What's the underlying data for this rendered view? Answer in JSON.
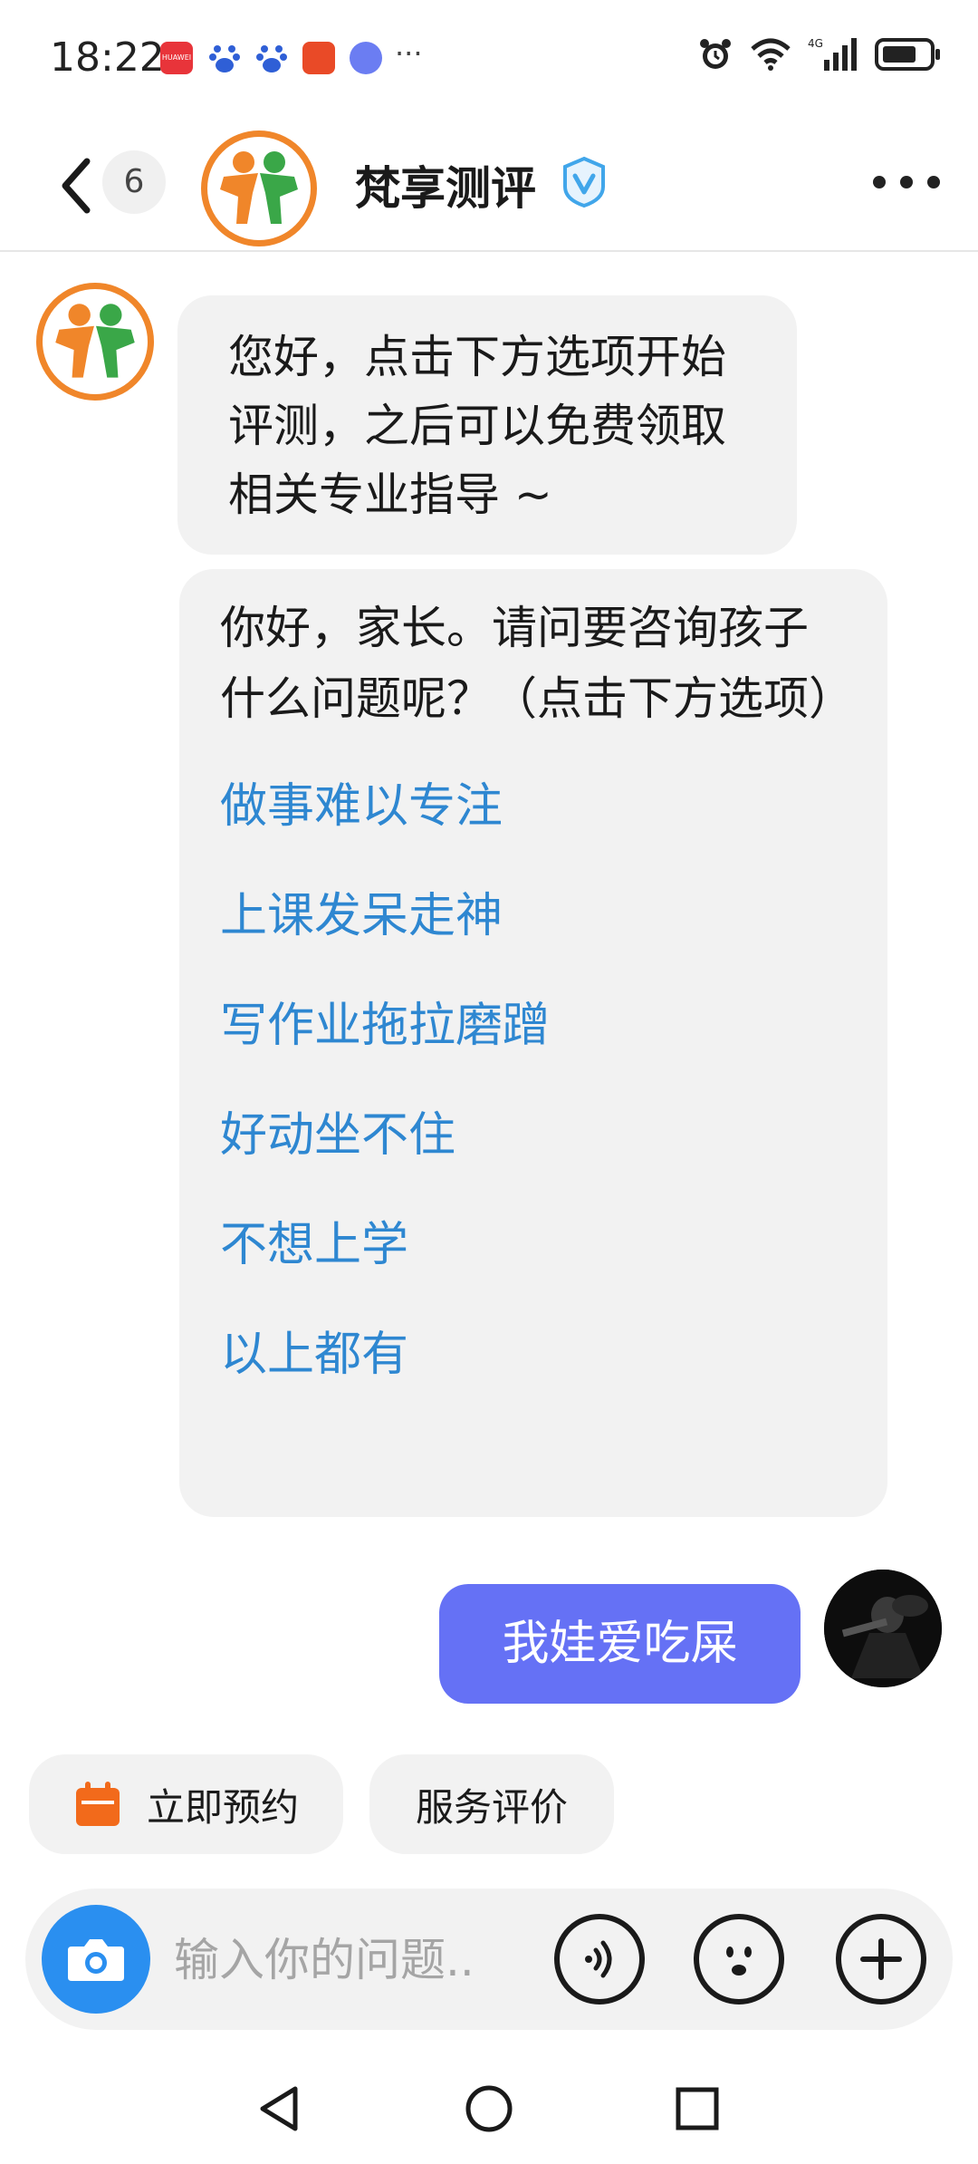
{
  "status_bar": {
    "time": "18:22",
    "huawei_label": "HUAWEI",
    "more": "···",
    "network": "4G"
  },
  "header": {
    "unread_count": "6",
    "title": "梵享测评"
  },
  "messages": {
    "greeting": "您好，点击下方选项开始评测，之后可以免费领取相关专业指导 ~",
    "question": "你好，家长。请问要咨询孩子什么问题呢？（点击下方选项）",
    "options": [
      "做事难以专注",
      "上课发呆走神",
      "写作业拖拉磨蹭",
      "好动坐不住",
      "不想上学",
      "以上都有"
    ],
    "user_reply": "我娃爱吃屎"
  },
  "quick_actions": {
    "booking": "立即预约",
    "rating": "服务评价"
  },
  "input_bar": {
    "placeholder": "输入你的问题.."
  },
  "colors": {
    "accent_blue": "#2a8ff0",
    "link_blue": "#2e87d1",
    "user_bubble": "#6571f5",
    "logo_orange": "#f0862a",
    "logo_green": "#3aa748",
    "calendar_orange": "#f26a1b"
  },
  "icons": {
    "back": "chevron-left-icon",
    "verified": "verified-v-icon",
    "more": "more-dots-icon",
    "camera": "camera-icon",
    "voice": "voice-icon",
    "emoji": "emoji-icon",
    "plus": "plus-icon",
    "calendar": "calendar-icon"
  }
}
